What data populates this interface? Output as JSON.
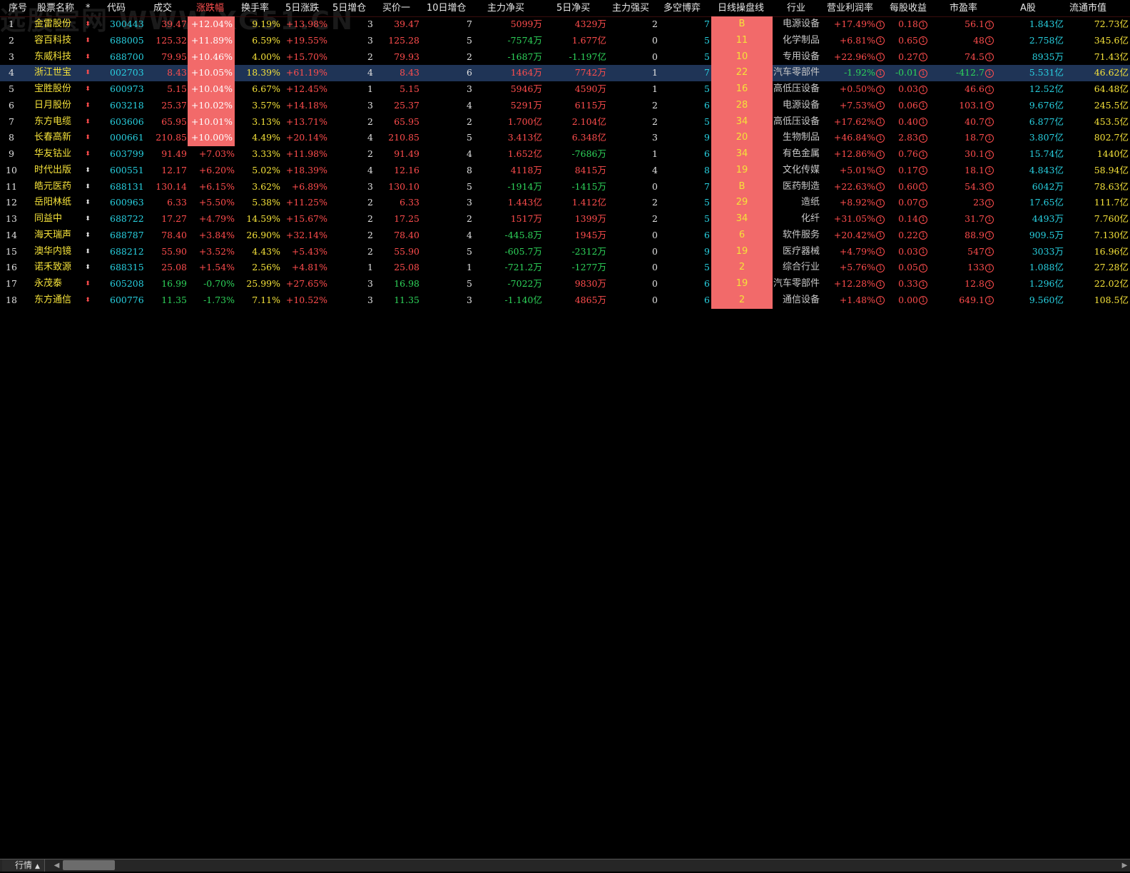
{
  "watermark": "选股宝网 WWW.XG51.CN",
  "columns": [
    {
      "key": "seq",
      "label": "序号"
    },
    {
      "key": "name",
      "label": "股票名称"
    },
    {
      "key": "star",
      "label": "*"
    },
    {
      "key": "code",
      "label": "代码"
    },
    {
      "key": "price",
      "label": "成交"
    },
    {
      "key": "chg",
      "label": "涨跌幅"
    },
    {
      "key": "turnover",
      "label": "换手率"
    },
    {
      "key": "chg5",
      "label": "5日涨跌"
    },
    {
      "key": "inc5",
      "label": "5日增仓"
    },
    {
      "key": "bid1",
      "label": "买价一"
    },
    {
      "key": "inc10",
      "label": "10日增仓"
    },
    {
      "key": "netbuy",
      "label": "主力净买"
    },
    {
      "key": "netbuy5",
      "label": "5日净买"
    },
    {
      "key": "strong",
      "label": "主力强买"
    },
    {
      "key": "game",
      "label": "多空博弈"
    },
    {
      "key": "daily",
      "label": "日线操盘线"
    },
    {
      "key": "industry",
      "label": "行业"
    },
    {
      "key": "margin",
      "label": "营业利润率"
    },
    {
      "key": "eps",
      "label": "每股收益"
    },
    {
      "key": "pe",
      "label": "市盈率"
    },
    {
      "key": "ashare",
      "label": "A股"
    },
    {
      "key": "mcap",
      "label": "流通市值"
    }
  ],
  "sorted_column": "涨跌幅",
  "selected_row": 4,
  "rows": [
    {
      "seq": "1",
      "name": "金雷股份",
      "code": "300443",
      "price": "39.47",
      "chg": "+12.04%",
      "turnover": "9.19%",
      "chg5": "+13.98%",
      "inc5": "3",
      "bid1": "39.47",
      "inc10": "7",
      "netbuy": "5099万",
      "netbuy5": "4329万",
      "strong": "2",
      "game": "7",
      "daily": "B",
      "industry": "电源设备",
      "margin": "+17.49%",
      "eps": "0.18",
      "pe": "56.1",
      "ashare": "1.843亿",
      "mcap": "72.73亿"
    },
    {
      "seq": "2",
      "name": "容百科技",
      "code": "688005",
      "price": "125.32",
      "chg": "+11.89%",
      "turnover": "6.59%",
      "chg5": "+19.55%",
      "inc5": "3",
      "bid1": "125.28",
      "inc10": "5",
      "netbuy": "-7574万",
      "netbuy5": "1.677亿",
      "strong": "0",
      "game": "5",
      "daily": "11",
      "industry": "化学制品",
      "margin": "+6.81%",
      "eps": "0.65",
      "pe": "48",
      "ashare": "2.758亿",
      "mcap": "345.6亿"
    },
    {
      "seq": "3",
      "name": "东威科技",
      "code": "688700",
      "price": "79.95",
      "chg": "+10.46%",
      "turnover": "4.00%",
      "chg5": "+15.70%",
      "inc5": "2",
      "bid1": "79.93",
      "inc10": "2",
      "netbuy": "-1687万",
      "netbuy5": "-1.197亿",
      "strong": "0",
      "game": "5",
      "daily": "10",
      "industry": "专用设备",
      "margin": "+22.96%",
      "eps": "0.27",
      "pe": "74.5",
      "ashare": "8935万",
      "mcap": "71.43亿"
    },
    {
      "seq": "4",
      "name": "浙江世宝",
      "code": "002703",
      "price": "8.43",
      "chg": "+10.05%",
      "turnover": "18.39%",
      "chg5": "+61.19%",
      "inc5": "4",
      "bid1": "8.43",
      "inc10": "6",
      "netbuy": "1464万",
      "netbuy5": "7742万",
      "strong": "1",
      "game": "7",
      "daily": "22",
      "industry": "汽车零部件",
      "margin": "-1.92%",
      "eps": "-0.01",
      "pe": "-412.7",
      "ashare": "5.531亿",
      "mcap": "46.62亿"
    },
    {
      "seq": "5",
      "name": "宝胜股份",
      "code": "600973",
      "price": "5.15",
      "chg": "+10.04%",
      "turnover": "6.67%",
      "chg5": "+12.45%",
      "inc5": "1",
      "bid1": "5.15",
      "inc10": "3",
      "netbuy": "5946万",
      "netbuy5": "4590万",
      "strong": "1",
      "game": "5",
      "daily": "16",
      "industry": "高低压设备",
      "margin": "+0.50%",
      "eps": "0.03",
      "pe": "46.6",
      "ashare": "12.52亿",
      "mcap": "64.48亿"
    },
    {
      "seq": "6",
      "name": "日月股份",
      "code": "603218",
      "price": "25.37",
      "chg": "+10.02%",
      "turnover": "3.57%",
      "chg5": "+14.18%",
      "inc5": "3",
      "bid1": "25.37",
      "inc10": "4",
      "netbuy": "5291万",
      "netbuy5": "6115万",
      "strong": "2",
      "game": "6",
      "daily": "28",
      "industry": "电源设备",
      "margin": "+7.53%",
      "eps": "0.06",
      "pe": "103.1",
      "ashare": "9.676亿",
      "mcap": "245.5亿"
    },
    {
      "seq": "7",
      "name": "东方电缆",
      "code": "603606",
      "price": "65.95",
      "chg": "+10.01%",
      "turnover": "3.13%",
      "chg5": "+13.71%",
      "inc5": "2",
      "bid1": "65.95",
      "inc10": "2",
      "netbuy": "1.700亿",
      "netbuy5": "2.104亿",
      "strong": "2",
      "game": "5",
      "daily": "34",
      "industry": "高低压设备",
      "margin": "+17.62%",
      "eps": "0.40",
      "pe": "40.7",
      "ashare": "6.877亿",
      "mcap": "453.5亿"
    },
    {
      "seq": "8",
      "name": "长春高新",
      "code": "000661",
      "price": "210.85",
      "chg": "+10.00%",
      "turnover": "4.49%",
      "chg5": "+20.14%",
      "inc5": "4",
      "bid1": "210.85",
      "inc10": "5",
      "netbuy": "3.413亿",
      "netbuy5": "6.348亿",
      "strong": "3",
      "game": "9",
      "daily": "20",
      "industry": "生物制品",
      "margin": "+46.84%",
      "eps": "2.83",
      "pe": "18.7",
      "ashare": "3.807亿",
      "mcap": "802.7亿"
    },
    {
      "seq": "9",
      "name": "华友钴业",
      "code": "603799",
      "price": "91.49",
      "chg": "+7.03%",
      "turnover": "3.33%",
      "chg5": "+11.98%",
      "inc5": "2",
      "bid1": "91.49",
      "inc10": "4",
      "netbuy": "1.652亿",
      "netbuy5": "-7686万",
      "strong": "1",
      "game": "6",
      "daily": "34",
      "industry": "有色金属",
      "margin": "+12.86%",
      "eps": "0.76",
      "pe": "30.1",
      "ashare": "15.74亿",
      "mcap": "1440亿"
    },
    {
      "seq": "10",
      "name": "时代出版",
      "code": "600551",
      "price": "12.17",
      "chg": "+6.20%",
      "turnover": "5.02%",
      "chg5": "+18.39%",
      "inc5": "4",
      "bid1": "12.16",
      "inc10": "8",
      "netbuy": "4118万",
      "netbuy5": "8415万",
      "strong": "4",
      "game": "8",
      "daily": "19",
      "industry": "文化传媒",
      "margin": "+5.01%",
      "eps": "0.17",
      "pe": "18.1",
      "ashare": "4.843亿",
      "mcap": "58.94亿"
    },
    {
      "seq": "11",
      "name": "皓元医药",
      "code": "688131",
      "price": "130.14",
      "chg": "+6.15%",
      "turnover": "3.62%",
      "chg5": "+6.89%",
      "inc5": "3",
      "bid1": "130.10",
      "inc10": "5",
      "netbuy": "-1914万",
      "netbuy5": "-1415万",
      "strong": "0",
      "game": "7",
      "daily": "B",
      "industry": "医药制造",
      "margin": "+22.63%",
      "eps": "0.60",
      "pe": "54.3",
      "ashare": "6042万",
      "mcap": "78.63亿"
    },
    {
      "seq": "12",
      "name": "岳阳林纸",
      "code": "600963",
      "price": "6.33",
      "chg": "+5.50%",
      "turnover": "5.38%",
      "chg5": "+11.25%",
      "inc5": "2",
      "bid1": "6.33",
      "inc10": "3",
      "netbuy": "1.443亿",
      "netbuy5": "1.412亿",
      "strong": "2",
      "game": "5",
      "daily": "29",
      "industry": "造纸",
      "margin": "+8.92%",
      "eps": "0.07",
      "pe": "23",
      "ashare": "17.65亿",
      "mcap": "111.7亿"
    },
    {
      "seq": "13",
      "name": "同益中",
      "code": "688722",
      "price": "17.27",
      "chg": "+4.79%",
      "turnover": "14.59%",
      "chg5": "+15.67%",
      "inc5": "2",
      "bid1": "17.25",
      "inc10": "2",
      "netbuy": "1517万",
      "netbuy5": "1399万",
      "strong": "2",
      "game": "5",
      "daily": "34",
      "industry": "化纤",
      "margin": "+31.05%",
      "eps": "0.14",
      "pe": "31.7",
      "ashare": "4493万",
      "mcap": "7.760亿"
    },
    {
      "seq": "14",
      "name": "海天瑞声",
      "code": "688787",
      "price": "78.40",
      "chg": "+3.84%",
      "turnover": "26.90%",
      "chg5": "+32.14%",
      "inc5": "2",
      "bid1": "78.40",
      "inc10": "4",
      "netbuy": "-445.8万",
      "netbuy5": "1945万",
      "strong": "0",
      "game": "6",
      "daily": "6",
      "industry": "软件服务",
      "margin": "+20.42%",
      "eps": "0.22",
      "pe": "88.9",
      "ashare": "909.5万",
      "mcap": "7.130亿"
    },
    {
      "seq": "15",
      "name": "澳华内镜",
      "code": "688212",
      "price": "55.90",
      "chg": "+3.52%",
      "turnover": "4.43%",
      "chg5": "+5.43%",
      "inc5": "2",
      "bid1": "55.90",
      "inc10": "5",
      "netbuy": "-605.7万",
      "netbuy5": "-2312万",
      "strong": "0",
      "game": "9",
      "daily": "19",
      "industry": "医疗器械",
      "margin": "+4.79%",
      "eps": "0.03",
      "pe": "547",
      "ashare": "3033万",
      "mcap": "16.96亿"
    },
    {
      "seq": "16",
      "name": "诺禾致源",
      "code": "688315",
      "price": "25.08",
      "chg": "+1.54%",
      "turnover": "2.56%",
      "chg5": "+4.81%",
      "inc5": "1",
      "bid1": "25.08",
      "inc10": "1",
      "netbuy": "-721.2万",
      "netbuy5": "-1277万",
      "strong": "0",
      "game": "5",
      "daily": "2",
      "industry": "综合行业",
      "margin": "+5.76%",
      "eps": "0.05",
      "pe": "133",
      "ashare": "1.088亿",
      "mcap": "27.28亿"
    },
    {
      "seq": "17",
      "name": "永茂泰",
      "code": "605208",
      "price": "16.99",
      "chg": "-0.70%",
      "turnover": "25.99%",
      "chg5": "+27.65%",
      "inc5": "3",
      "bid1": "16.98",
      "inc10": "5",
      "netbuy": "-7022万",
      "netbuy5": "9830万",
      "strong": "0",
      "game": "6",
      "daily": "19",
      "industry": "汽车零部件",
      "margin": "+12.28%",
      "eps": "0.33",
      "pe": "12.8",
      "ashare": "1.296亿",
      "mcap": "22.02亿"
    },
    {
      "seq": "18",
      "name": "东方通信",
      "code": "600776",
      "price": "11.35",
      "chg": "-1.73%",
      "turnover": "7.11%",
      "chg5": "+10.52%",
      "inc5": "3",
      "bid1": "11.35",
      "inc10": "3",
      "netbuy": "-1.140亿",
      "netbuy5": "4865万",
      "strong": "0",
      "game": "6",
      "daily": "2",
      "industry": "通信设备",
      "margin": "+1.48%",
      "eps": "0.00",
      "pe": "649.1",
      "ashare": "9.560亿",
      "mcap": "108.5亿"
    }
  ],
  "colors": {
    "up": "#ff4d4d",
    "down": "#2ed35a",
    "name": "#f5e23a",
    "code": "#28d0e0",
    "highlight_fill": "#f26a6a",
    "selected_row_bg": "#1f3456",
    "background": "#000000"
  },
  "icons": {
    "star_col": "sort-updown-icon",
    "info_badge": "circled-1-icon",
    "tab_arrow": "caret-up-icon"
  },
  "statusbar": {
    "tab_label": "行情"
  }
}
